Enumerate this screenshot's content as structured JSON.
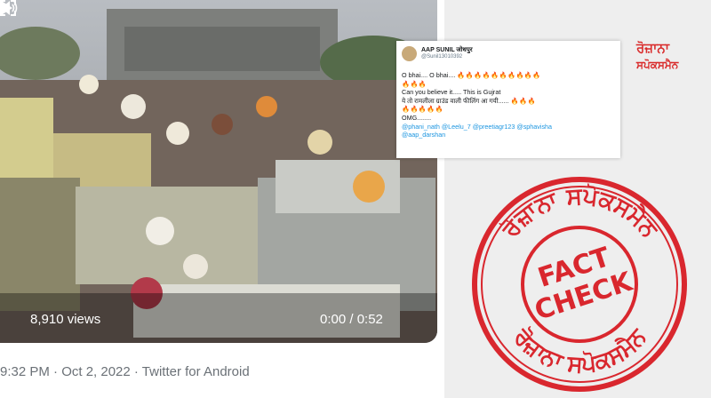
{
  "video": {
    "views": "8,910 views",
    "time": "0:00 / 0:52"
  },
  "tweet_meta": "9:32 PM · Oct 2, 2022 · Twitter for Android",
  "tweet": {
    "name": "AAP SUNIL जोधपुर",
    "handle": "@Sunil13010392",
    "lines": [
      {
        "text": "O bhai.... O bhai.... ",
        "fire": "🔥🔥🔥🔥🔥🔥🔥🔥🔥🔥"
      },
      {
        "text": "",
        "fire": "🔥🔥🔥"
      },
      {
        "text": "Can you believe it..... This is Gujrat",
        "fire": ""
      },
      {
        "text": "ये तो रामलीला ग्राउंड वाली फीलिंग आ गयी...... ",
        "fire": "🔥🔥🔥"
      },
      {
        "text": "",
        "fire": "🔥🔥🔥🔥🔥"
      },
      {
        "text": "OMG........",
        "fire": ""
      }
    ],
    "mentions": "@phani_nath @Leelu_7 @preetiagr123 @sphavisha",
    "mentions2": "@aap_darshan"
  },
  "logo": {
    "line1": "ਰੋਜ਼ਾਨਾ",
    "line2": "ਸਪੋਕਸਮੈਨ"
  },
  "stamp": {
    "top_arc": "ਰੋਜ਼ਾਨਾ ਸਪੋਕਸਮੈਨ",
    "bottom_arc": "ਰੋਜ਼ਾਨਾ ਸਪੋਕਸਮੈਨ",
    "word1": "FACT",
    "word2": "CHECK",
    "color": "#d9272e"
  },
  "colors": {
    "accent_red": "#d92a2a",
    "mention_blue": "#1b95e0",
    "fire_orange": "#f2731c"
  }
}
